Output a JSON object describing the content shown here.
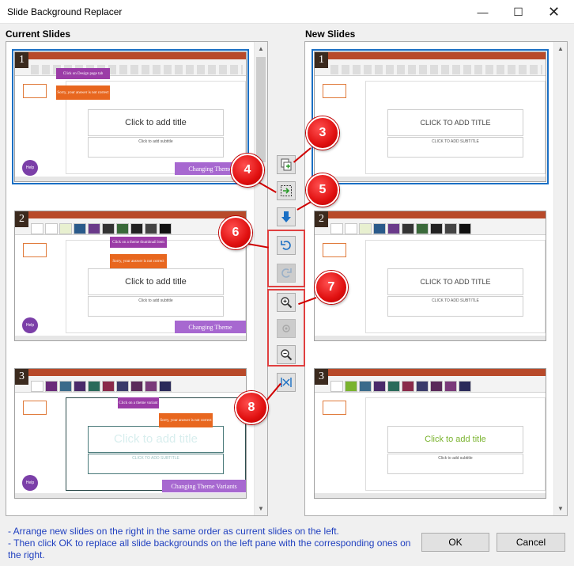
{
  "window": {
    "title": "Slide Background Replacer",
    "minimize_glyph": "—",
    "maximize_glyph": "☐",
    "close_glyph": "✕"
  },
  "left_pane": {
    "label": "Current Slides",
    "slides": [
      {
        "number": "1",
        "title": "Click to add title",
        "subtitle": "Click to add subtitle",
        "callout_1": "Click on Design page tab",
        "callout_2": "Sorry, your answer is not correct",
        "banner": "Changing Theme",
        "help": "Help"
      },
      {
        "number": "2",
        "title": "Click to add title",
        "subtitle": "Click to add subtitle",
        "callout_1": "Click on a theme thumbnail item",
        "callout_2": "Sorry, your answer is not correct",
        "banner": "Changing Theme",
        "help": "Help"
      },
      {
        "number": "3",
        "title": "Click to add title",
        "subtitle": "CLICK TO ADD SUBTITLE",
        "callout_1": "Click on a theme variant",
        "callout_2": "Sorry, your answer is not correct",
        "banner": "Changing Theme Variants",
        "help": "Help"
      }
    ]
  },
  "right_pane": {
    "label": "New Slides",
    "slides": [
      {
        "number": "1",
        "title": "CLICK TO ADD TITLE",
        "subtitle": "CLICK TO ADD SUBTITLE"
      },
      {
        "number": "2",
        "title": "CLICK TO ADD TITLE",
        "subtitle": "CLICK TO ADD SUBTITLE"
      },
      {
        "number": "3",
        "title": "Click to add title",
        "subtitle": "Click to add subtitle"
      }
    ]
  },
  "toolbar": {
    "icons": [
      "copy-slide-icon",
      "select-slide-icon",
      "move-down-icon",
      "undo-icon",
      "redo-icon",
      "zoom-in-icon",
      "zoom-reset-icon",
      "zoom-out-icon",
      "fit-icon"
    ]
  },
  "annotations": [
    "3",
    "4",
    "5",
    "6",
    "7",
    "8"
  ],
  "instructions": [
    "- Arrange new slides on the right in the same order as current slides on the left.",
    "- Then click OK to replace all slide backgrounds on the left pane with the corresponding ones on the right."
  ],
  "buttons": {
    "ok": "OK",
    "cancel": "Cancel"
  },
  "colors": {
    "accent": "#1a6fc4",
    "annotation_red": "#e01010",
    "instruction_text": "#1f3fbf",
    "ribbon": "#b84a2a"
  }
}
